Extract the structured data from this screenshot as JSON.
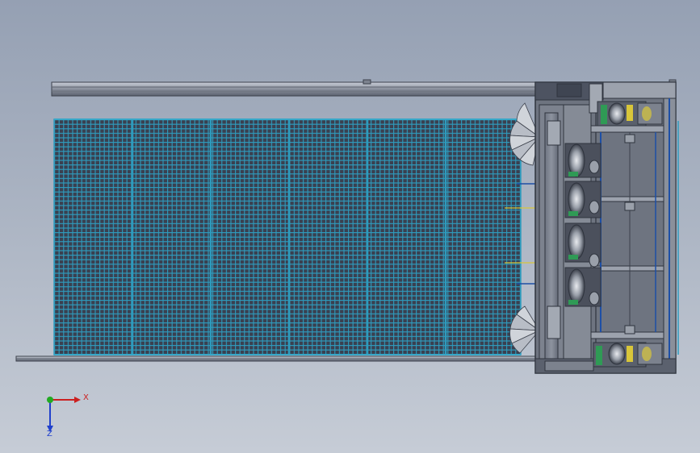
{
  "viewport": {
    "background_top": "#95a0b3",
    "background_bottom": "#c6ccd6"
  },
  "model": {
    "mesh_color": "#2e9bbd",
    "frame_color": "#4d5361",
    "panel_color": "#808691",
    "accent_blue": "#1d4fa6",
    "accent_yellow": "#d8c63a"
  },
  "triad": {
    "x_label": "X",
    "z_label": "Z",
    "x_color": "#cc2020",
    "y_color": "#22aa22",
    "z_color": "#2040cc"
  }
}
